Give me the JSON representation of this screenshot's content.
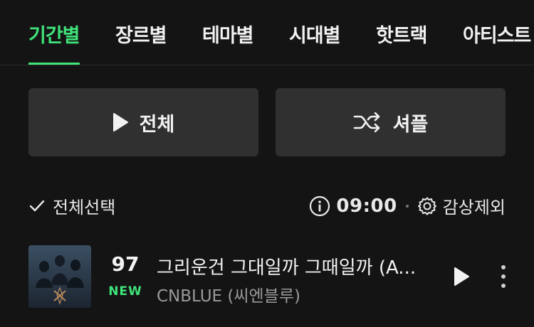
{
  "tabs": [
    {
      "label": "기간별",
      "active": true
    },
    {
      "label": "장르별",
      "active": false
    },
    {
      "label": "테마별",
      "active": false
    },
    {
      "label": "시대별",
      "active": false
    },
    {
      "label": "핫트랙",
      "active": false
    },
    {
      "label": "아티스트",
      "active": false
    }
  ],
  "actions": {
    "play_all_label": "전체",
    "shuffle_label": "셔플"
  },
  "options": {
    "select_all_label": "전체선택",
    "total_duration": "09:00",
    "exclude_label": "감상제외"
  },
  "tracks": [
    {
      "rank": "97",
      "badge": "NEW",
      "title": "그리운건 그대일까 그때일까 (A...",
      "artist": "CNBLUE (씨엔블루)"
    }
  ],
  "colors": {
    "accent": "#3fe37a",
    "background": "#141414",
    "button": "#303030"
  },
  "icons": {
    "play": "play-icon",
    "shuffle": "shuffle-icon",
    "check": "check-icon",
    "info": "info-icon",
    "settings": "gear-icon",
    "more": "more-vertical-icon"
  }
}
